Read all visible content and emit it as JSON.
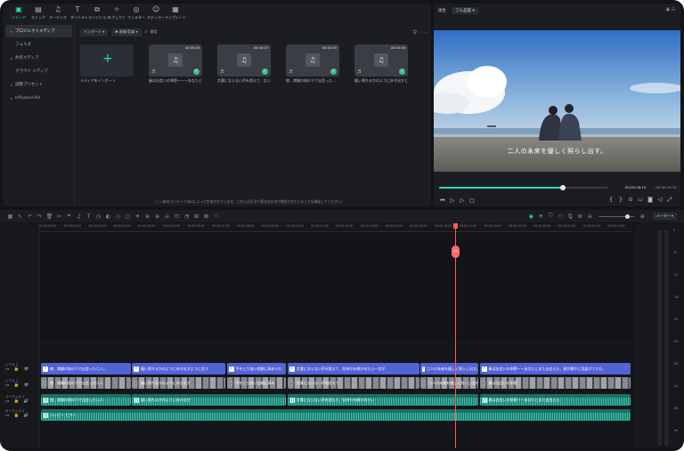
{
  "asset_tabs": [
    {
      "label": "メディア",
      "icon": "media-icon",
      "active": true
    },
    {
      "label": "ストック",
      "icon": "stock-icon"
    },
    {
      "label": "オーディオ",
      "icon": "music-note-icon"
    },
    {
      "label": "タイトル",
      "icon": "text-icon"
    },
    {
      "label": "トランジション",
      "icon": "transition-icon"
    },
    {
      "label": "エフェクト",
      "icon": "effect-icon"
    },
    {
      "label": "フィルター",
      "icon": "filter-icon"
    },
    {
      "label": "ステッカー",
      "icon": "sticker-icon"
    },
    {
      "label": "テンプレート",
      "icon": "template-icon"
    }
  ],
  "side_nav": [
    {
      "label": "プロジェクトメディア",
      "active": true,
      "chevron": "▾"
    },
    {
      "label": "フォルダ",
      "chevron": ""
    },
    {
      "label": "共有メディア",
      "chevron": "▸"
    },
    {
      "label": "クラウド メディア",
      "chevron": ""
    },
    {
      "label": "調整プリセット",
      "chevron": "▸"
    },
    {
      "label": "Influence Kit",
      "chevron": "▸"
    }
  ],
  "media_toolbar": {
    "import_label": "インポート ▾",
    "ai_label": "✱ 画像/音楽 ▾",
    "search_placeholder": "検索"
  },
  "media_cards": [
    {
      "type": "import",
      "caption": "メディアをインポート"
    },
    {
      "type": "audio",
      "duration": "00:00:06",
      "caption": "春は出会いの季節ーーーあなたとは..."
    },
    {
      "type": "audio",
      "duration": "00:00:07",
      "caption": "言葉にならない声を超えて、ないほうが..."
    },
    {
      "type": "audio",
      "duration": "00:00:05",
      "caption": "夜、満開の桜の下で出会った..."
    },
    {
      "type": "audio",
      "duration": "00:00:06",
      "caption": "暖い落ちるかのように歩き出すとき..."
    }
  ],
  "ai_notice": "ⓘ 一部のコンテンツはAIによって生成されています。これらは正当で適法な方法で使用されていることを確認してください。",
  "preview": {
    "label": "再生",
    "quality": "フル品質 ▾",
    "subtitle": "二人の未来を優しく照らし出す。",
    "time_current": "00:00:16:15",
    "time_total": "/ 00:00:23:10",
    "progress": 0.73
  },
  "timeline": {
    "ruler_ticks": [
      "00:00:00:00",
      "00:00:01:00",
      "00:00:02:00",
      "00:00:03:00",
      "00:00:04:00",
      "00:00:05:00",
      "00:00:06:00",
      "00:00:07:00",
      "00:00:08:00",
      "00:00:09:00",
      "00:00:10:00",
      "00:00:11:00",
      "00:00:12:00",
      "00:00:13:00",
      "00:00:14:00",
      "00:00:15:00",
      "00:00:16:00",
      "00:00:17:00",
      "00:00:18:00",
      "00:00:19:00",
      "00:00:20:00",
      "00:00:21:00",
      "00:00:22:00",
      "00:00:23:00"
    ],
    "meter_label": "メーター ▾",
    "playhead_fraction": 0.701,
    "track_headers": [
      {
        "name": "ビデオ 2",
        "icons": "▭ 🔒 👁"
      },
      {
        "name": "ビデオ 1",
        "icons": "▭ 🔒 👁"
      },
      {
        "name": "オーディオ 1",
        "icons": "▭ 🔒 🔊"
      },
      {
        "name": "オーディオ 2",
        "icons": "▭ 🔒 🔊"
      }
    ],
    "title_clips": [
      {
        "text": "夜、満開の桜の下で出会った二人。",
        "start": 0.0,
        "end": 0.152
      },
      {
        "text": "優い落ちるかのように歩き出すように言う",
        "start": 0.154,
        "end": 0.313
      },
      {
        "text": "手をとり強い信頼に高められ",
        "start": 0.315,
        "end": 0.416
      },
      {
        "text": "言葉にならない声を超えて、気持ちを確かめたい一言が",
        "start": 0.418,
        "end": 0.642
      },
      {
        "text": "二人の未来を優しく照らし出す。",
        "start": 0.644,
        "end": 0.742
      },
      {
        "text": "春は出会いの季節ーーあなたとまた出会えた、桜が静かに見届けていた。",
        "start": 0.744,
        "end": 1.0
      }
    ],
    "video_clips": [
      {
        "text": "夜、満開の桜の下で出会った二人",
        "start": 0.0,
        "end": 0.152
      },
      {
        "text": "優い落ちるかのように歩き出す",
        "start": 0.154,
        "end": 0.313
      },
      {
        "text": "手をとり強い信頼に高め",
        "start": 0.315,
        "end": 0.416
      },
      {
        "text": "言葉にならない声を超えて",
        "start": 0.418,
        "end": 0.642
      },
      {
        "text": "二人の未来を優しく照らし出す",
        "start": 0.644,
        "end": 0.742
      },
      {
        "text": "春は出会いの季節",
        "start": 0.744,
        "end": 1.0
      }
    ],
    "audio_clips": [
      {
        "text": "夜、満開の桜の下で出会った二人",
        "start": 0.0,
        "end": 0.152
      },
      {
        "text": "優い落ちるかのように歩き出す",
        "start": 0.154,
        "end": 0.416
      },
      {
        "text": "言葉にならない声を超えて、気持ちを確かめたい",
        "start": 0.418,
        "end": 0.742
      },
      {
        "text": "春は出会いの季節ーーあなたとまた出会えた",
        "start": 0.744,
        "end": 1.0
      }
    ],
    "music_clip": {
      "text": "ハッピー ピアノ",
      "start": 0.0,
      "end": 1.0
    },
    "db_labels": [
      "0",
      "-6",
      "-12",
      "-18",
      "-24",
      "-30",
      "-36",
      "-42",
      "-48",
      "-54"
    ]
  },
  "colors": {
    "accent": "#35d5b5",
    "playhead": "#ff5b5b",
    "title_clip": "#5263d6"
  }
}
